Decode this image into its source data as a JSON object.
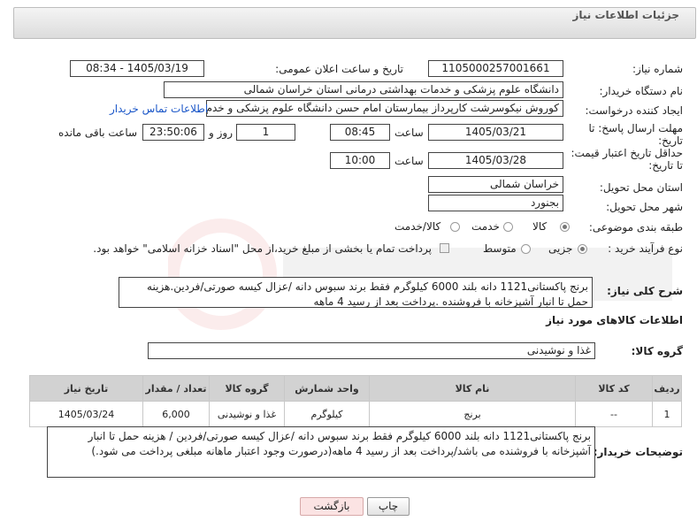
{
  "header": {
    "title": "جزئیات اطلاعات نیاز"
  },
  "need_number": {
    "label": "شماره نیاز:",
    "value": "1105000257001661"
  },
  "announce_datetime": {
    "label": "تاریخ و ساعت اعلان عمومی:",
    "value": "1405/03/19 - 08:34"
  },
  "buyer_org": {
    "label": "نام دستگاه خریدار:",
    "value": "دانشگاه علوم پزشکی و خدمات بهداشتی درمانی استان خراسان شمالی"
  },
  "requester": {
    "label": "ایجاد کننده درخواست:",
    "value": "کوروش نیکوسرشت کارپرداز بیمارستان امام حسن دانشگاه علوم پزشکی و خدم",
    "contact_link": "اطلاعات تماس خریدار"
  },
  "reply_deadline": {
    "label_line1": "مهلت ارسال پاسخ: تا",
    "label_line2": "تاریخ:",
    "date": "1405/03/21",
    "time_label": "ساعت",
    "time": "08:45",
    "days": "1",
    "days_label": "روز و",
    "remaining": "23:50:06",
    "remaining_label": "ساعت باقی مانده"
  },
  "price_validity": {
    "label_line1": "حداقل تاریخ اعتبار قیمت:",
    "label_line2": "تا تاریخ:",
    "date": "1405/03/28",
    "time_label": "ساعت",
    "time": "10:00"
  },
  "delivery_province": {
    "label": "استان محل تحویل:",
    "value": "خراسان شمالی"
  },
  "delivery_city": {
    "label": "شهر محل تحویل:",
    "value": "بجنورد"
  },
  "category": {
    "label": "طبقه بندی موضوعی:",
    "options": [
      "کالا",
      "خدمت",
      "کالا/خدمت"
    ],
    "selected": "کالا"
  },
  "purchase_process": {
    "label": "نوع فرآیند خرید :",
    "options": [
      "جزیی",
      "متوسط"
    ],
    "selected": "جزیی",
    "treasury_note": "پرداخت تمام یا بخشی از مبلغ خرید،از محل \"اسناد خزانه اسلامی\" خواهد بود."
  },
  "general_description": {
    "label": "شرح کلی نیاز:",
    "value": "برنج پاکستانی1121 دانه بلند 6000 کیلوگرم فقط برند سبوس دانه /عزال کیسه صورتی/فردین.هزینه حمل تا انبار آشپزخانه با فروشنده .پرداخت بعد از رسید 4 ماهه"
  },
  "goods_section": {
    "title": "اطلاعات کالاهای مورد نیاز"
  },
  "goods_group": {
    "label": "گروه کالا:",
    "value": "غذا و نوشیدنی"
  },
  "items_table": {
    "headers": [
      "ردیف",
      "کد کالا",
      "نام کالا",
      "واحد شمارش",
      "گروه کالا",
      "تعداد / مقدار",
      "تاریخ نیاز"
    ],
    "rows": [
      [
        "1",
        "--",
        "برنج",
        "کیلوگرم",
        "غذا و نوشیدنی",
        "6,000",
        "1405/03/24"
      ]
    ]
  },
  "buyer_notes": {
    "label": "توضیحات خریدار:",
    "value": "برنج پاکستانی1121 دانه بلند 6000 کیلوگرم فقط برند سبوس دانه /عزال کیسه صورتی/فردین / هزینه حمل تا انبار آشپزخانه با فروشنده می باشد/پرداخت بعد از رسید 4 ماهه(درصورت وجود اعتبار ماهانه مبلغی پرداخت می شود.)"
  },
  "buttons": {
    "print": "چاپ",
    "back": "بازگشت"
  },
  "colors": {
    "link": "#1a56c8",
    "back_button_bg": "#fbe3e3",
    "table_header_bg": "#d2d2d2"
  }
}
